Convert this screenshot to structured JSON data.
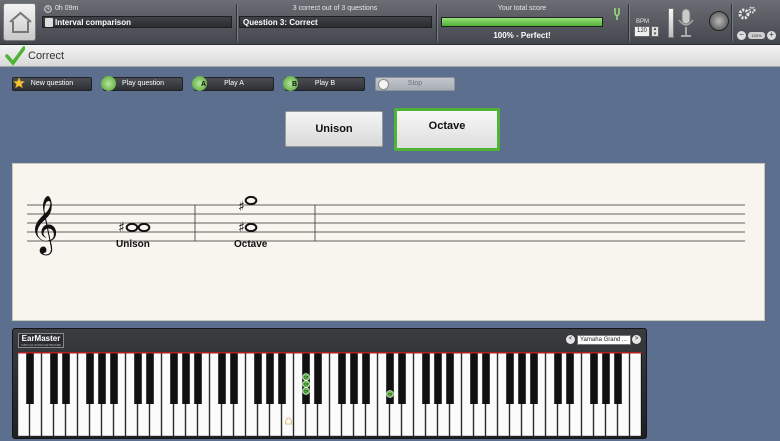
{
  "header": {
    "timer": "0h 09m",
    "exercise_title": "Interval comparison",
    "questions_summary": "3 correct out of 3 questions",
    "question_status": "Question 3: Correct",
    "score_label": "Your total score",
    "score_percent": 100,
    "score_text": "100% - Perfect!",
    "bpm_label": "BPM",
    "bpm_value": "120",
    "zoom_value": "100%"
  },
  "status": {
    "text": "Correct"
  },
  "toolbar": {
    "new_question": "New question",
    "play_question": "Play question",
    "play_a": "Play A",
    "play_b": "Play B",
    "stop": "Stop",
    "badge_a": "A",
    "badge_b": "B"
  },
  "answers": {
    "unison": "Unison",
    "octave": "Octave"
  },
  "score_sheet": {
    "label1": "Unison",
    "label2": "Octave"
  },
  "piano": {
    "brand": "EarMaster",
    "brand_sub": "VIRTUAL PIANO KEYBOARD",
    "instrument": "Yamaha Grand ...",
    "prev": "<",
    "next": ">",
    "marker_a": "C#",
    "marker_b": "C#"
  },
  "colors": {
    "accent_green": "#4fb336",
    "progress_green": "#6fcf4f",
    "panel_blue": "#5c6f8f"
  }
}
